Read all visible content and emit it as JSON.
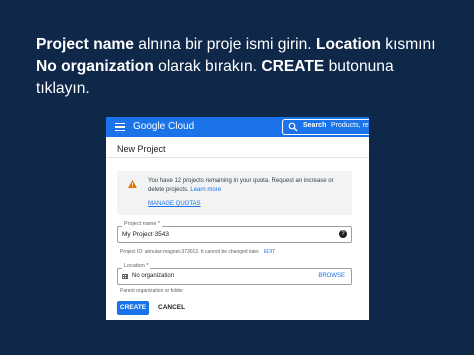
{
  "instruction": {
    "part1_bold": "Project name",
    "part2": " alnına bir proje ismi girin. ",
    "part3_bold": "Location",
    "part4": " kısmını ",
    "part5_bold": "No organization",
    "part6": " olarak bırakın. ",
    "part7_bold": "CREATE",
    "part8": " butonuna tıklayın."
  },
  "header": {
    "logo": "Google Cloud",
    "search_label": "Search",
    "search_placeholder": "Products, re"
  },
  "page": {
    "title": "New Project"
  },
  "quota": {
    "text": "You have 12 projects remaining in your quota. Request an increase or delete projects.",
    "learn_more": "Learn more",
    "manage_quotas": "MANAGE QUOTAS"
  },
  "project_name": {
    "label": "Project name *",
    "value": "My Project 3543",
    "hint": "Project ID: annular-magnet-373012. It cannot be changed later.",
    "edit": "EDIT"
  },
  "location": {
    "label": "Location *",
    "value": "No organization",
    "browse": "BROWSE",
    "hint": "Parent organization or folder"
  },
  "actions": {
    "create": "CREATE",
    "cancel": "CANCEL"
  },
  "colors": {
    "background": "#0f2748",
    "accent": "#1a73e8",
    "warning": "#e37400"
  }
}
